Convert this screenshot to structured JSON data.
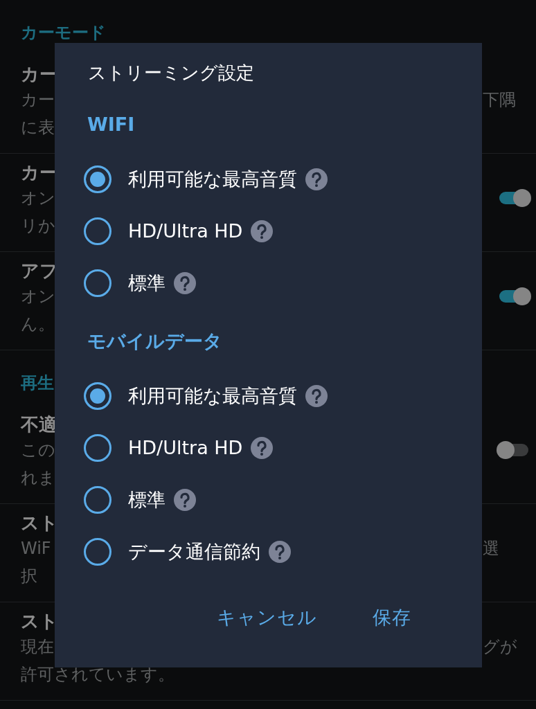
{
  "background": {
    "sections": [
      {
        "header": "カーモード",
        "rows": [
          {
            "title": "カー",
            "description": [
              "カー",
              "に表"
            ],
            "trailing_text": "下隅"
          },
          {
            "title": "カー",
            "description": [
              "オン",
              "リか"
            ],
            "toggle": {
              "on": true
            }
          },
          {
            "title": "アフ",
            "description": [
              "オン",
              "ん。"
            ],
            "toggle": {
              "on": true
            }
          }
        ]
      },
      {
        "header": "再生",
        "rows": [
          {
            "title": "不適",
            "description": [
              "この",
              "れま"
            ],
            "toggle": {
              "on": false
            }
          },
          {
            "title": "スト",
            "description": [
              "WiF",
              "択"
            ],
            "trailing_text": "選"
          },
          {
            "title": "スト",
            "description": [
              "現在",
              "許可されています。"
            ],
            "trailing_text": "グが"
          }
        ]
      }
    ]
  },
  "dialog": {
    "title": "ストリーミング設定",
    "groups": [
      {
        "header": "WIFI",
        "options": [
          {
            "label": "利用可能な最高音質",
            "selected": true
          },
          {
            "label": "HD/Ultra HD",
            "selected": false
          },
          {
            "label": "標準",
            "selected": false
          }
        ]
      },
      {
        "header": "モバイルデータ",
        "options": [
          {
            "label": "利用可能な最高音質",
            "selected": true
          },
          {
            "label": "HD/Ultra HD",
            "selected": false
          },
          {
            "label": "標準",
            "selected": false
          },
          {
            "label": "データ通信節約",
            "selected": false
          }
        ]
      }
    ],
    "buttons": [
      "キャンセル",
      "保存"
    ]
  }
}
